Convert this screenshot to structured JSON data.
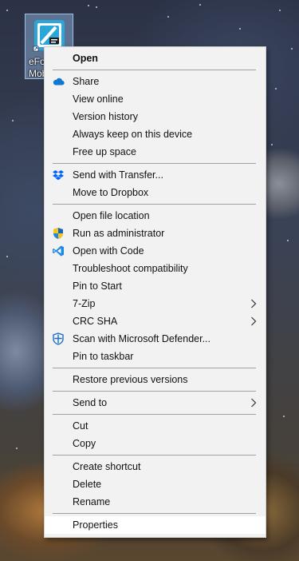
{
  "desktop": {
    "icon_label": "eFou\nMob"
  },
  "menu": {
    "groups": [
      [
        {
          "label": "Open",
          "bold": true
        }
      ],
      [
        {
          "label": "Share",
          "icon": "onedrive-cloud-icon"
        },
        {
          "label": "View online"
        },
        {
          "label": "Version history"
        },
        {
          "label": "Always keep on this device"
        },
        {
          "label": "Free up space"
        }
      ],
      [
        {
          "label": "Send with Transfer...",
          "icon": "dropbox-icon"
        },
        {
          "label": "Move to Dropbox"
        }
      ],
      [
        {
          "label": "Open file location"
        },
        {
          "label": "Run as administrator",
          "icon": "uac-shield-icon"
        },
        {
          "label": "Open with Code",
          "icon": "vscode-icon"
        },
        {
          "label": "Troubleshoot compatibility"
        },
        {
          "label": "Pin to Start"
        },
        {
          "label": "7-Zip",
          "submenu": true
        },
        {
          "label": "CRC SHA",
          "submenu": true
        },
        {
          "label": "Scan with Microsoft Defender...",
          "icon": "defender-shield-icon"
        },
        {
          "label": "Pin to taskbar"
        }
      ],
      [
        {
          "label": "Restore previous versions"
        }
      ],
      [
        {
          "label": "Send to",
          "submenu": true
        }
      ],
      [
        {
          "label": "Cut"
        },
        {
          "label": "Copy"
        }
      ],
      [
        {
          "label": "Create shortcut"
        },
        {
          "label": "Delete"
        },
        {
          "label": "Rename"
        }
      ],
      [
        {
          "label": "Properties",
          "highlighted": true
        }
      ]
    ]
  },
  "colors": {
    "menu_bg": "#f2f2f2",
    "highlight_bg": "#ffffff",
    "separator": "#a0a0a0",
    "onedrive_blue": "#0f78d4",
    "dropbox_blue": "#0061fe",
    "vscode_blue": "#1e88e5",
    "uac_yellow": "#f5c518",
    "defender_blue": "#1b6fc2"
  }
}
